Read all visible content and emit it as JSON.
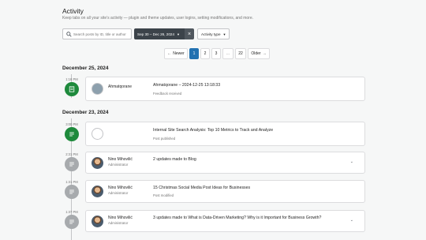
{
  "header": {
    "title": "Activity",
    "subtitle": "Keep tabs on all your site’s activity — plugin and theme updates, user logins, setting modifications, and more."
  },
  "filters": {
    "search_placeholder": "Search posts by ID, title or author",
    "date_range": "Sep 30 – Dec 26, 2024",
    "clear_label": "×",
    "activity_type": "Activity type"
  },
  "pagination": {
    "newer": "Newer",
    "pages": [
      "1",
      "2",
      "3",
      "...",
      "22"
    ],
    "active_page": "1",
    "older": "Older"
  },
  "groups": [
    {
      "date": "December 25, 2024"
    },
    {
      "date": "December 23, 2024"
    }
  ],
  "entries": [
    {
      "time": "1:18 PM",
      "user": "Ahmatqorane",
      "role": "",
      "title": "Ahmatqorane – 2024-12-25 13:18:33",
      "status": "Feedback received",
      "icon": "form-icon",
      "icon_color": "#1e8a3c",
      "avatar": "site-logo",
      "expandable": false
    },
    {
      "time": "3:00 PM",
      "user": "",
      "role": "",
      "title": "Internal Site Search Analysis: Top 10 Metrics to Track and Analyze",
      "status": "Post published",
      "icon": "post-icon",
      "icon_color": "#1e8a3c",
      "avatar": "blank",
      "expandable": false
    },
    {
      "time": "2:31 PM",
      "user": "Nino Mihovilić",
      "role": "Administrator",
      "title": "2 updates made to Blog",
      "status": "",
      "icon": "post-icon",
      "icon_color": "#a7aaad",
      "avatar": "photo",
      "expandable": true
    },
    {
      "time": "1:31 PM",
      "user": "Nino Mihovilić",
      "role": "Administrator",
      "title": "15 Christmas Social Media Post Ideas for Businesses",
      "status": "Post modified",
      "icon": "post-icon",
      "icon_color": "#a7aaad",
      "avatar": "photo",
      "expandable": false
    },
    {
      "time": "1:37 PM",
      "user": "Nino Mihovilić",
      "role": "Administrator",
      "title": "3 updates made to What is Data-Driven Marketing? Why is it Important for Business Growth?",
      "status": "",
      "icon": "post-icon",
      "icon_color": "#a7aaad",
      "avatar": "photo",
      "expandable": true
    }
  ]
}
